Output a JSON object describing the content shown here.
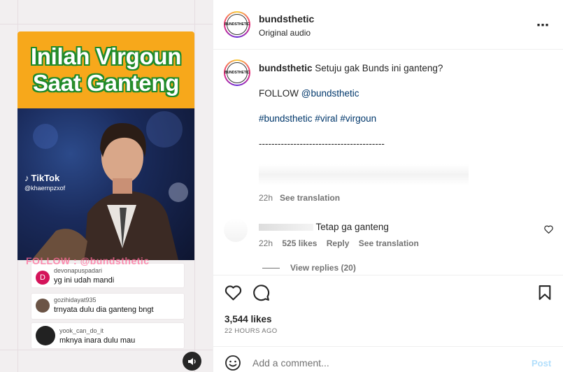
{
  "media": {
    "banner_line1": "Inilah Virgoun",
    "banner_line2": "Saat Ganteng",
    "tiktok_label": "TikTok",
    "tiktok_handle": "@khaernpzxof",
    "follow_overlay": "FOLLOW : @bundsthetic",
    "comments": [
      {
        "user": "devonapuspadari",
        "text": "yg ini udah mandi",
        "avatar_letter": "D",
        "avatar_color": "#d4145a"
      },
      {
        "user": "gozihidayat935",
        "text": "trnyata dulu dia ganteng bngt",
        "avatar_color": "#6b5446"
      },
      {
        "user": "yook_can_do_it",
        "text": "mknya inara dulu mau",
        "avatar_color": "#222222"
      }
    ]
  },
  "header": {
    "username": "bundsthetic",
    "subtitle": "Original audio",
    "avatar_text": "BUNDSTHETIC",
    "more_icon": "⋯"
  },
  "caption": {
    "username": "bundsthetic",
    "text": "Setuju gak Bunds ini ganteng?",
    "follow_prefix": "FOLLOW",
    "follow_mention": "@bundsthetic",
    "hashtags": "#bundsthetic #viral #virgoun",
    "divider": "----------------------------------------",
    "time": "22h",
    "see_translation": "See translation"
  },
  "comment": {
    "text": "Tetap ga ganteng",
    "time": "22h",
    "likes": "525 likes",
    "reply": "Reply",
    "see_translation": "See translation",
    "view_replies": "View replies (20)"
  },
  "footer": {
    "likes": "3,544 likes",
    "time_ago": "22 HOURS AGO",
    "comment_placeholder": "Add a comment...",
    "post_label": "Post"
  },
  "colors": {
    "banner": "#f7a81b",
    "link": "#00376b",
    "post_disabled": "#b2dffc"
  }
}
